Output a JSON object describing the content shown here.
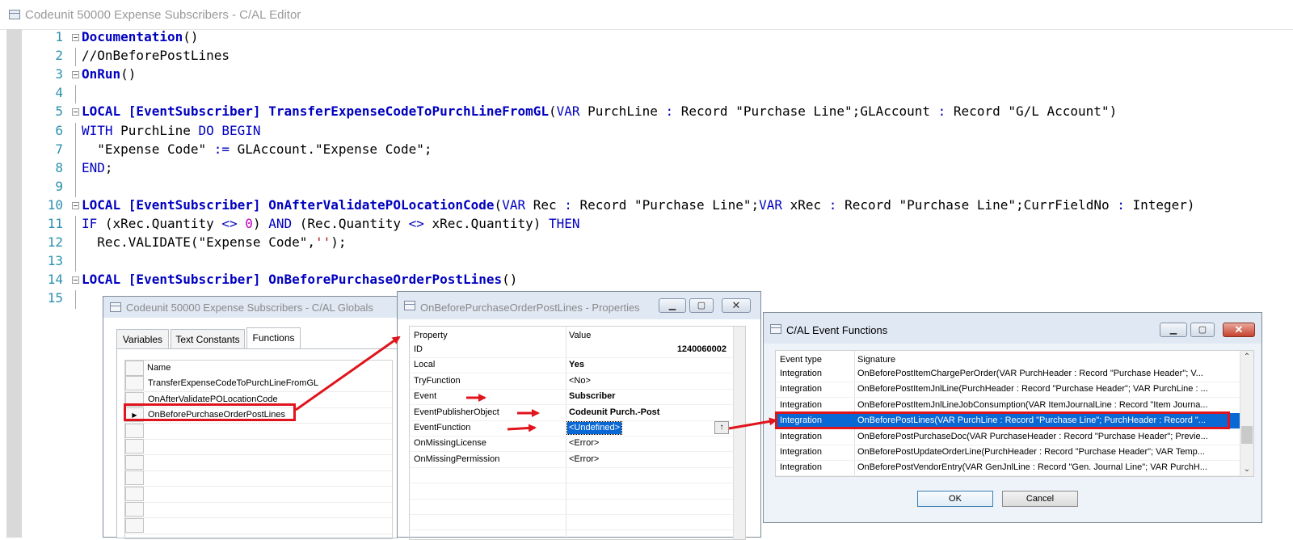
{
  "editor": {
    "title": "Codeunit 50000 Expense Subscribers - C/AL Editor",
    "lines": [
      {
        "n": "1",
        "segs": [
          {
            "t": "Documentation",
            "c": "kw b"
          },
          {
            "t": "()",
            "c": ""
          }
        ]
      },
      {
        "n": "2",
        "segs": [
          {
            "t": "//OnBeforePostLines",
            "c": ""
          }
        ]
      },
      {
        "n": "3",
        "segs": [
          {
            "t": "OnRun",
            "c": "kw b"
          },
          {
            "t": "()",
            "c": ""
          }
        ]
      },
      {
        "n": "4",
        "segs": []
      },
      {
        "n": "5",
        "segs": [
          {
            "t": "LOCAL [EventSubscriber] TransferExpenseCodeToPurchLineFromGL",
            "c": "kw b"
          },
          {
            "t": "(",
            "c": ""
          },
          {
            "t": "VAR",
            "c": "kw"
          },
          {
            "t": " PurchLine ",
            "c": ""
          },
          {
            "t": ":",
            "c": "op"
          },
          {
            "t": " Record \"Purchase Line\";GLAccount ",
            "c": ""
          },
          {
            "t": ":",
            "c": "op"
          },
          {
            "t": " Record \"G/L Account\")",
            "c": ""
          }
        ]
      },
      {
        "n": "6",
        "segs": [
          {
            "t": "WITH",
            "c": "kw"
          },
          {
            "t": " PurchLine ",
            "c": ""
          },
          {
            "t": "DO BEGIN",
            "c": "kw"
          }
        ]
      },
      {
        "n": "7",
        "segs": [
          {
            "t": "  \"Expense Code\" ",
            "c": ""
          },
          {
            "t": ":=",
            "c": "op"
          },
          {
            "t": " GLAccount.\"Expense Code\";",
            "c": ""
          }
        ]
      },
      {
        "n": "8",
        "segs": [
          {
            "t": "END",
            "c": "kw"
          },
          {
            "t": ";",
            "c": ""
          }
        ]
      },
      {
        "n": "9",
        "segs": []
      },
      {
        "n": "10",
        "segs": [
          {
            "t": "LOCAL [EventSubscriber] OnAfterValidatePOLocationCode",
            "c": "kw b"
          },
          {
            "t": "(",
            "c": ""
          },
          {
            "t": "VAR",
            "c": "kw"
          },
          {
            "t": " Rec ",
            "c": ""
          },
          {
            "t": ":",
            "c": "op"
          },
          {
            "t": " Record \"Purchase Line\";",
            "c": ""
          },
          {
            "t": "VAR",
            "c": "kw"
          },
          {
            "t": " xRec ",
            "c": ""
          },
          {
            "t": ":",
            "c": "op"
          },
          {
            "t": " Record \"Purchase Line\";CurrFieldNo ",
            "c": ""
          },
          {
            "t": ":",
            "c": "op"
          },
          {
            "t": " Integer)",
            "c": ""
          }
        ]
      },
      {
        "n": "11",
        "segs": [
          {
            "t": "IF",
            "c": "kw"
          },
          {
            "t": " (xRec.Quantity ",
            "c": ""
          },
          {
            "t": "<>",
            "c": "op"
          },
          {
            "t": " ",
            "c": ""
          },
          {
            "t": "0",
            "c": "num"
          },
          {
            "t": ") ",
            "c": ""
          },
          {
            "t": "AND",
            "c": "kw"
          },
          {
            "t": " (Rec.Quantity ",
            "c": ""
          },
          {
            "t": "<>",
            "c": "op"
          },
          {
            "t": " xRec.Quantity) ",
            "c": ""
          },
          {
            "t": "THEN",
            "c": "kw"
          }
        ]
      },
      {
        "n": "12",
        "segs": [
          {
            "t": "  Rec.VALIDATE(\"Expense Code\",",
            "c": ""
          },
          {
            "t": "''",
            "c": "str"
          },
          {
            "t": ");",
            "c": ""
          }
        ]
      },
      {
        "n": "13",
        "segs": []
      },
      {
        "n": "14",
        "segs": [
          {
            "t": "LOCAL [EventSubscriber] OnBeforePurchaseOrderPostLines",
            "c": "kw b"
          },
          {
            "t": "()",
            "c": ""
          }
        ]
      },
      {
        "n": "15",
        "segs": []
      }
    ]
  },
  "globals": {
    "title": "Codeunit 50000 Expense Subscribers - C/AL Globals",
    "tabs": [
      "Variables",
      "Text Constants",
      "Functions"
    ],
    "active_tab": "Functions",
    "column": "Name",
    "functions": [
      "TransferExpenseCodeToPurchLineFromGL",
      "OnAfterValidatePOLocationCode",
      "OnBeforePurchaseOrderPostLines"
    ],
    "current_marker": "▶"
  },
  "properties": {
    "title": "OnBeforePurchaseOrderPostLines - Properties",
    "col_property": "Property",
    "col_value": "Value",
    "rows": [
      {
        "p": "ID",
        "v": "1240060002",
        "bold": true,
        "align": "right"
      },
      {
        "p": "Local",
        "v": "Yes",
        "bold": true
      },
      {
        "p": "TryFunction",
        "v": "<No>"
      },
      {
        "p": "Event",
        "v": "Subscriber",
        "bold": true
      },
      {
        "p": "EventPublisherObject",
        "v": "Codeunit Purch.-Post",
        "bold": true
      },
      {
        "p": "EventFunction",
        "v": "<Undefined>",
        "selected": true
      },
      {
        "p": "OnMissingLicense",
        "v": "<Error>"
      },
      {
        "p": "OnMissingPermission",
        "v": "<Error>"
      }
    ],
    "lookup_glyph": "↑"
  },
  "event_functions": {
    "title": "C/AL Event Functions",
    "col_type": "Event type",
    "col_signature": "Signature",
    "rows": [
      {
        "type": "Integration",
        "sig": "OnBeforePostItemChargePerOrder(VAR PurchHeader : Record \"Purchase Header\"; V..."
      },
      {
        "type": "Integration",
        "sig": "OnBeforePostItemJnlLine(PurchHeader : Record \"Purchase Header\"; VAR PurchLine : ..."
      },
      {
        "type": "Integration",
        "sig": "OnBeforePostItemJnlLineJobConsumption(VAR ItemJournalLine : Record \"Item Journa..."
      },
      {
        "type": "Integration",
        "sig": "OnBeforePostLines(VAR PurchLine : Record \"Purchase Line\"; PurchHeader : Record \"...",
        "selected": true
      },
      {
        "type": "Integration",
        "sig": "OnBeforePostPurchaseDoc(VAR PurchaseHeader : Record \"Purchase Header\"; Previe..."
      },
      {
        "type": "Integration",
        "sig": "OnBeforePostUpdateOrderLine(PurchHeader : Record \"Purchase Header\"; VAR Temp..."
      },
      {
        "type": "Integration",
        "sig": "OnBeforePostVendorEntry(VAR GenJnlLine : Record \"Gen. Journal Line\"; VAR PurchH..."
      }
    ],
    "ok_label": "OK",
    "cancel_label": "Cancel"
  },
  "colors": {
    "keyword": "#0000c0",
    "line_number": "#2b91af",
    "highlight": "#e0141c",
    "selection": "#0a68d4"
  }
}
